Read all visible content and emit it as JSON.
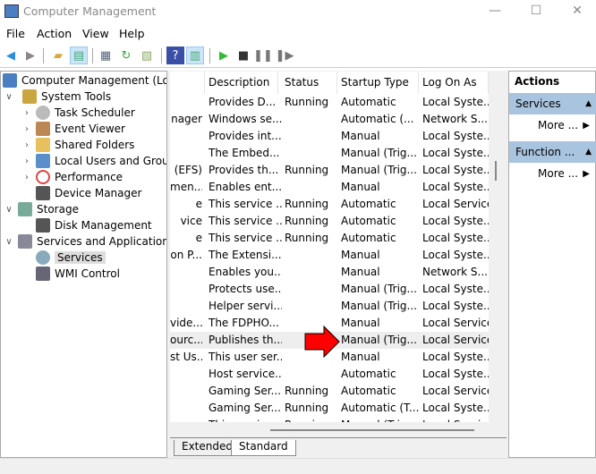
{
  "window": {
    "title": "Computer Management",
    "minimize": "—",
    "maximize": "☐",
    "close": "✕"
  },
  "menu": [
    "File",
    "Action",
    "View",
    "Help"
  ],
  "tree": [
    {
      "label": "Computer Management (Local",
      "expander": "",
      "icon": "#4a7fc1"
    },
    {
      "label": "System Tools",
      "expander": "∨",
      "icon": "#c9a640"
    },
    {
      "label": "Task Scheduler",
      "expander": "›",
      "icon": "#bbb"
    },
    {
      "label": "Event Viewer",
      "expander": "›",
      "icon": "#b85"
    },
    {
      "label": "Shared Folders",
      "expander": "›",
      "icon": "#e8c060"
    },
    {
      "label": "Local Users and Groups",
      "expander": "›",
      "icon": "#5a8fc9"
    },
    {
      "label": "Performance",
      "expander": "›",
      "icon": "#d44"
    },
    {
      "label": "Device Manager",
      "expander": "",
      "icon": "#555"
    },
    {
      "label": "Storage",
      "expander": "∨",
      "icon": "#7a9"
    },
    {
      "label": "Disk Management",
      "expander": "",
      "icon": "#555"
    },
    {
      "label": "Services and Applications",
      "expander": "∨",
      "icon": "#889"
    },
    {
      "label": "Services",
      "expander": "",
      "icon": "#8ab"
    },
    {
      "label": "WMI Control",
      "expander": "",
      "icon": "#667"
    }
  ],
  "columns": [
    "Description",
    "Status",
    "Startup Type",
    "Log On As"
  ],
  "rows": [
    [
      "",
      "Provides D...",
      "Running",
      "Automatic",
      "Local Syste..."
    ],
    [
      "nager",
      "Windows se...",
      "",
      "Automatic (...",
      "Network S..."
    ],
    [
      "",
      "Provides int...",
      "",
      "Manual",
      "Local Syste..."
    ],
    [
      "",
      "The Embed...",
      "",
      "Manual (Trig...",
      "Local Syste..."
    ],
    [
      "(EFS)",
      "Provides th...",
      "Running",
      "Manual (Trig...",
      "Local Syste..."
    ],
    [
      "men...",
      "Enables ent...",
      "",
      "Manual",
      "Local Syste..."
    ],
    [
      "e",
      "This service ...",
      "Running",
      "Automatic",
      "Local Service"
    ],
    [
      "vice",
      "This service ...",
      "Running",
      "Automatic",
      "Local Syste..."
    ],
    [
      "e",
      "This service ...",
      "Running",
      "Automatic",
      "Local Syste..."
    ],
    [
      "on P...",
      "The Extensi...",
      "",
      "Manual",
      "Local Syste..."
    ],
    [
      "",
      "Enables you...",
      "",
      "Manual",
      "Network S..."
    ],
    [
      "",
      "Protects use...",
      "",
      "Manual (Trig...",
      "Local Syste..."
    ],
    [
      "",
      "Helper servi...",
      "",
      "Manual (Trig...",
      "Local Syste..."
    ],
    [
      "vide...",
      "The FDPHO...",
      "",
      "Manual",
      "Local Service"
    ],
    [
      "ourc...",
      "Publishes th...",
      "",
      "Manual (Trig...",
      "Local Service"
    ],
    [
      "st Us...",
      "This user ser...",
      "",
      "Manual",
      "Local Syste..."
    ],
    [
      "",
      "Host service...",
      "",
      "Automatic",
      "Local Syste..."
    ],
    [
      "",
      "Gaming Ser...",
      "Running",
      "Automatic",
      "Local Service"
    ],
    [
      "",
      "Gaming Ser...",
      "Running",
      "Automatic (T...",
      "Local Syste..."
    ],
    [
      "",
      "This service ...",
      "Running",
      "Manual (Trig...",
      "Local Service"
    ]
  ],
  "tabs": [
    "Extended",
    "Standard"
  ],
  "actions": {
    "title": "Actions",
    "sections": [
      {
        "label": "Services",
        "more": "More ..."
      },
      {
        "label": "Function ...",
        "more": "More ..."
      }
    ]
  },
  "colors": {
    "highlight_arrow": "#ff0000",
    "action_header": "#a9c4de"
  }
}
